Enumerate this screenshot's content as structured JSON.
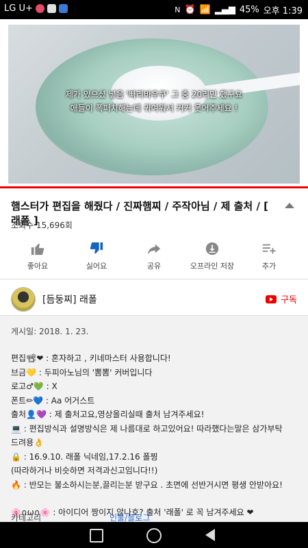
{
  "status_bar": {
    "carrier": "LG U+",
    "battery": "45%",
    "time": "오후 1:39"
  },
  "video": {
    "subtitle_line1": "제가 있으셨 넣음 '빠리바우쿠' 그 중 20리만 했구요",
    "subtitle_line2": "애들이 폭퍼치해는데 귀여워서 커커 웃어주세요 !",
    "progress_percent": 100
  },
  "title": "햄스터가 편집을 해줬다 / 진짜햄찌 / 주작아님 / 제 출처 / [ 래폴 ]",
  "views": "조회수 15,696회",
  "actions": {
    "like": "좋아요",
    "dislike": "싫어요",
    "share": "공유",
    "offline": "오프라인 저장",
    "add": "추가"
  },
  "channel": {
    "name": "[듬둥찌] 래폴",
    "subscribe": "구독"
  },
  "description": {
    "date": "게시일: 2018. 1. 23.",
    "lines": [
      "편집📽❤ : 혼자하고 , 키네마스터 사용합니다!",
      "브금💛 : 두피아노님의 '뽐뽐' 커버입니다",
      "로고♂💚 : X",
      "폰트✏💙 : Aa 어거스트",
      "출처👤💜 : 제 출처고요,영상올리실때 출처 남겨주세요!",
      "💻 : 편집방식과 설명방식은 제 나름대로 하고있어요! 따라했다는말은 삼가부탁",
      "드려용👌",
      "🔒 : 16.9.10. 래폴 닉네임,17.2.16 폴찡",
      "(따라하거나 비슷하면 저격과신고임니다!!)",
      "🔥 : 반모는 불소하시는분,끌리는분 받구요 . 초면에 선반거시면 평생 안받아요!",
      "",
      "🌸∩ω∩🌸 : 아이디어 짱이지 않나호? 출처 '래폴' 로 꼭 남겨주세요 ❤"
    ],
    "bottom_left": "카테고리",
    "bottom_right": "인물/블로그"
  },
  "colors": {
    "accent": "#e00000",
    "link": "#2a6bd6"
  }
}
